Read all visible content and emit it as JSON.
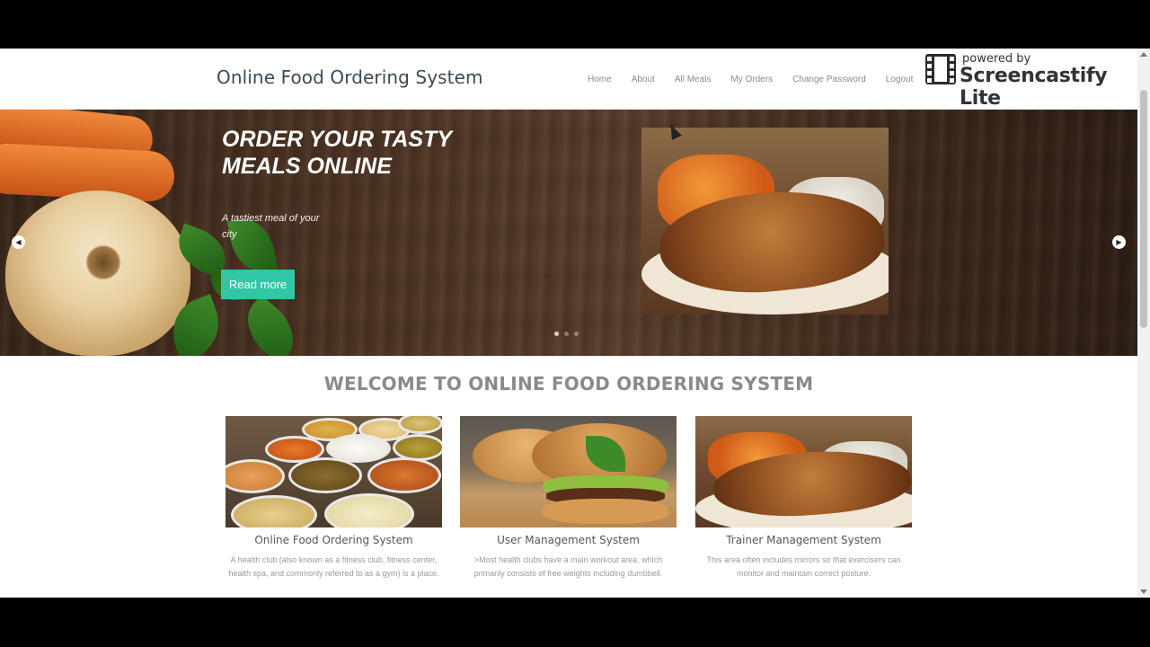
{
  "header": {
    "brand": "Online Food Ordering System",
    "nav": [
      "Home",
      "About",
      "All Meals",
      "My Orders",
      "Change Password",
      "Logout"
    ]
  },
  "watermark": {
    "small": "powered by",
    "big": "Screencastify Lite"
  },
  "hero": {
    "title": "ORDER YOUR TASTY MEALS ONLINE",
    "subtitle": "A tastiest meal of your city",
    "button": "Read more",
    "prev_icon": "chevron-left-icon",
    "next_icon": "chevron-right-icon",
    "slides": 3,
    "active_slide": 1
  },
  "welcome": "WELCOME TO ONLINE FOOD ORDERING SYSTEM",
  "cards": [
    {
      "title": "Online Food Ordering System",
      "text": "A health club (also known as a fitness club, fitness center, health spa, and commonly referred to as a gym) is a place."
    },
    {
      "title": "User Management System",
      "text": ">Most health clubs have a main workout area, which primarily consists of free weights including dumbbell."
    },
    {
      "title": "Trainer Management System",
      "text": "This area often includes mirrors so that exercisers can monitor and maintain correct posture."
    }
  ],
  "colors": {
    "accent": "#31c6a6",
    "nav_text": "#8a8a8a",
    "brand_text": "#3a4a55"
  }
}
